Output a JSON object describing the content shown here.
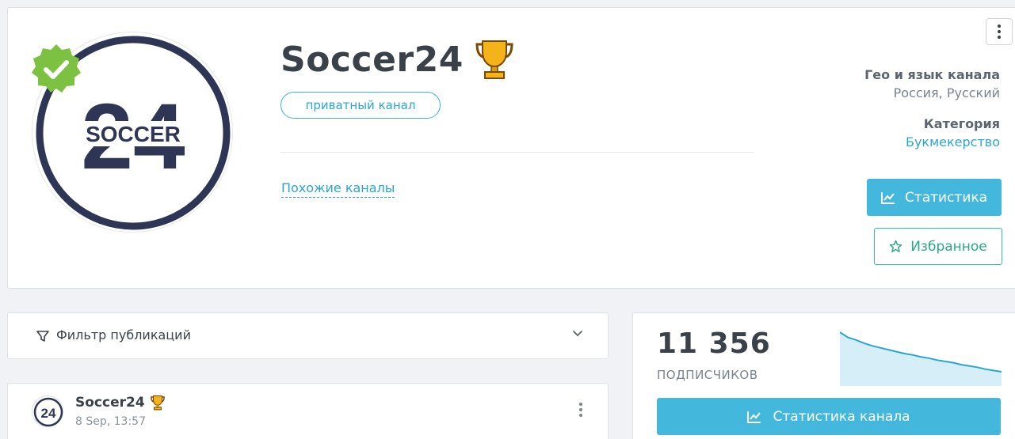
{
  "channel": {
    "name": "Soccer24",
    "logo_text_top": "24",
    "logo_text_word": "SOCCER",
    "privacy_badge": "приватный канал",
    "similar_link": "Похожие каналы"
  },
  "meta": {
    "geo_label": "Гео и язык канала",
    "geo_value": "Россия, Русский",
    "category_label": "Категория",
    "category_value": "Букмекерство"
  },
  "actions": {
    "stats_label": "Статистика",
    "favorite_label": "Избранное"
  },
  "filter": {
    "label": "Фильтр публикаций"
  },
  "post": {
    "author": "Soccer24",
    "date": "8 Sep, 13:57"
  },
  "subscribers": {
    "count": "11 356",
    "label": "ПОДПИСЧИКОВ",
    "trend": [
      100,
      92,
      88,
      83,
      79,
      76,
      73,
      70,
      67,
      65,
      62,
      60,
      57,
      55,
      53,
      50,
      48,
      46,
      43,
      41,
      39
    ],
    "button_label": "Статистика канала"
  },
  "colors": {
    "accent": "#44b7dd",
    "success": "#2fbf9c",
    "verified": "#7cc142",
    "logo_navy": "#2f3555"
  },
  "icons": {
    "verified": "verified-badge-icon",
    "trophy": "trophy-icon",
    "chart": "chart-line-icon",
    "star": "star-icon",
    "filter": "filter-icon",
    "chevron": "chevron-down-icon",
    "menu": "kebab-menu-icon"
  }
}
